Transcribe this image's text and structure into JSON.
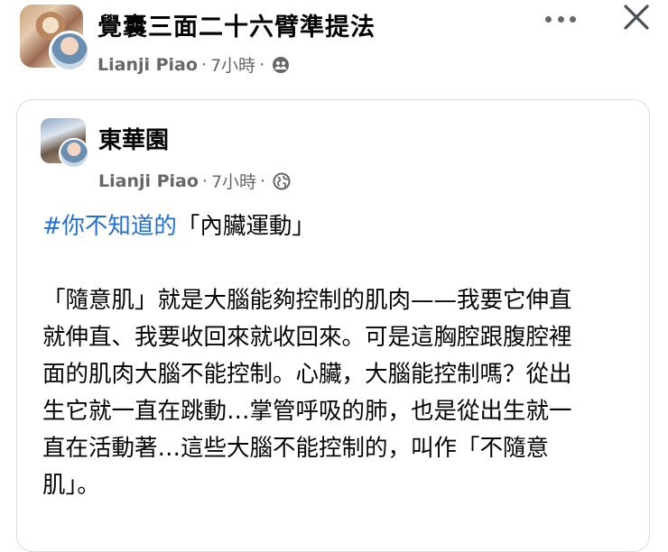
{
  "header": {
    "group_title": "覺囊三面二十六臂準提法",
    "author": "Lianji Piao",
    "separator": "·",
    "time": "7小時",
    "audience_icon": "group-audience-icon",
    "more_icon": "more-options-icon",
    "close_icon": "close-icon"
  },
  "card": {
    "page_name": "東華園",
    "author": "Lianji Piao",
    "separator": "·",
    "time": "7小時",
    "audience_icon": "globe-icon"
  },
  "post": {
    "hashtag": "#你不知道的",
    "hashtag_rest": "「內臟運動」",
    "lines": [
      "「隨意肌」就是大腦能夠控制的肌肉——我要它伸直",
      "就伸直、我要收回來就收回來。可是這胸腔跟腹腔裡",
      "面的肌肉大腦不能控制。心臟，大腦能控制嗎？從出",
      "生它就一直在跳動…掌管呼吸的肺，也是從出生就一",
      "直在活動著…這些大腦不能控制的，叫作「不隨意",
      "肌」。"
    ]
  }
}
